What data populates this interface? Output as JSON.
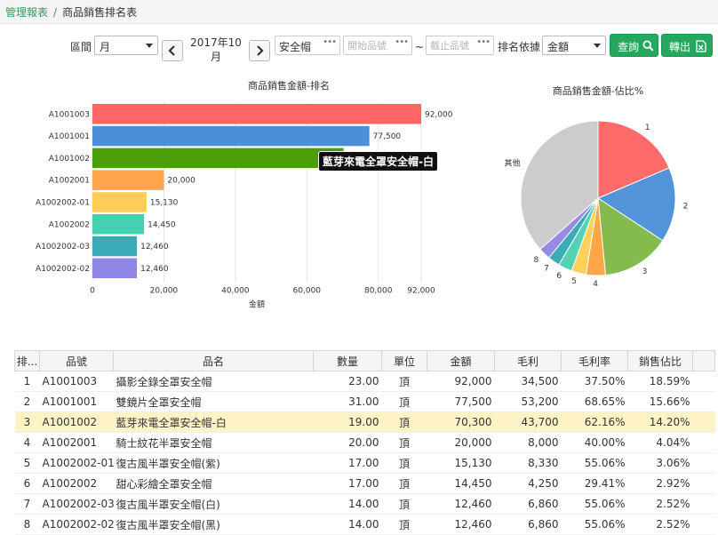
{
  "breadcrumb": {
    "parent": "管理報表",
    "current": "商品銷售排名表"
  },
  "filters": {
    "interval_label": "區間",
    "interval_value": "月",
    "period_line1": "2017年10",
    "period_line2": "月",
    "category_value": "安全帽",
    "start_placeholder": "開始品號",
    "tilde": "~",
    "end_placeholder": "截止品號",
    "rank_by_label": "排名依據",
    "rank_by_value": "金額",
    "query_label": "查詢",
    "export_label": "轉出"
  },
  "colors": {
    "accent": "#25a75d",
    "highlight": "#fdf3c7"
  },
  "tooltip": "藍芽來電全罩安全帽-白",
  "chart_data": [
    {
      "type": "bar",
      "orientation": "horizontal",
      "title": "商品銷售金額-排名",
      "xlabel": "金額",
      "categories": [
        "A1001003",
        "A1001001",
        "A1001002",
        "A1002001",
        "A1002002-01",
        "A1002002",
        "A1002002-03",
        "A1002002-02"
      ],
      "values": [
        92000,
        77500,
        70300,
        20000,
        15130,
        14450,
        12460,
        12460
      ],
      "value_labels": [
        "92,000",
        "77,500",
        "",
        "20,000",
        "15,130",
        "14,450",
        "12,460",
        "12,460"
      ],
      "colors": [
        "#ff6666",
        "#4a90d9",
        "#4b9e0a",
        "#ffa64d",
        "#ffcc55",
        "#44d1b1",
        "#3aacb7",
        "#8f86e6"
      ],
      "xlim": [
        0,
        92000
      ],
      "ticks": [
        "0",
        "20,000",
        "40,000",
        "60,000",
        "80,000",
        "92,000"
      ],
      "tick_values": [
        0,
        20000,
        40000,
        60000,
        80000,
        92000
      ],
      "grid": true
    },
    {
      "type": "pie",
      "title": "商品銷售金額-佔比%",
      "labels": [
        "1",
        "2",
        "3",
        "4",
        "5",
        "6",
        "7",
        "8",
        "其他"
      ],
      "values": [
        18.59,
        15.66,
        14.2,
        4.04,
        3.06,
        2.92,
        2.52,
        2.52,
        36.49
      ],
      "colors": [
        "#ff6b6b",
        "#5294d8",
        "#84bb4c",
        "#ffa647",
        "#ffd05a",
        "#55d1b4",
        "#3cabb8",
        "#978be3",
        "#cccccc"
      ]
    }
  ],
  "table": {
    "columns": [
      "排...",
      "品號",
      "品名",
      "數量",
      "單位",
      "金額",
      "毛利",
      "毛利率",
      "銷售佔比"
    ],
    "rows": [
      [
        "1",
        "A1001003",
        "攝影全錄全罩安全帽",
        "23.00",
        "頂",
        "92,000",
        "34,500",
        "37.50%",
        "18.59%"
      ],
      [
        "2",
        "A1001001",
        "雙鏡片全罩安全帽",
        "31.00",
        "頂",
        "77,500",
        "53,200",
        "68.65%",
        "15.66%"
      ],
      [
        "3",
        "A1001002",
        "藍芽來電全罩安全帽-白",
        "19.00",
        "頂",
        "70,300",
        "43,700",
        "62.16%",
        "14.20%"
      ],
      [
        "4",
        "A1002001",
        "騎士紋花半罩安全帽",
        "20.00",
        "頂",
        "20,000",
        "8,000",
        "40.00%",
        "4.04%"
      ],
      [
        "5",
        "A1002002-01",
        "復古風半罩安全帽(紫)",
        "17.00",
        "頂",
        "15,130",
        "8,330",
        "55.06%",
        "3.06%"
      ],
      [
        "6",
        "A1002002",
        "甜心彩繪全罩安全帽",
        "17.00",
        "頂",
        "14,450",
        "4,250",
        "29.41%",
        "2.92%"
      ],
      [
        "7",
        "A1002002-03",
        "復古風半罩安全帽(白)",
        "14.00",
        "頂",
        "12,460",
        "6,860",
        "55.06%",
        "2.52%"
      ],
      [
        "8",
        "A1002002-02",
        "復古風半罩安全帽(黑)",
        "14.00",
        "頂",
        "12,460",
        "6,860",
        "55.06%",
        "2.52%"
      ]
    ],
    "highlighted_row": 2
  }
}
